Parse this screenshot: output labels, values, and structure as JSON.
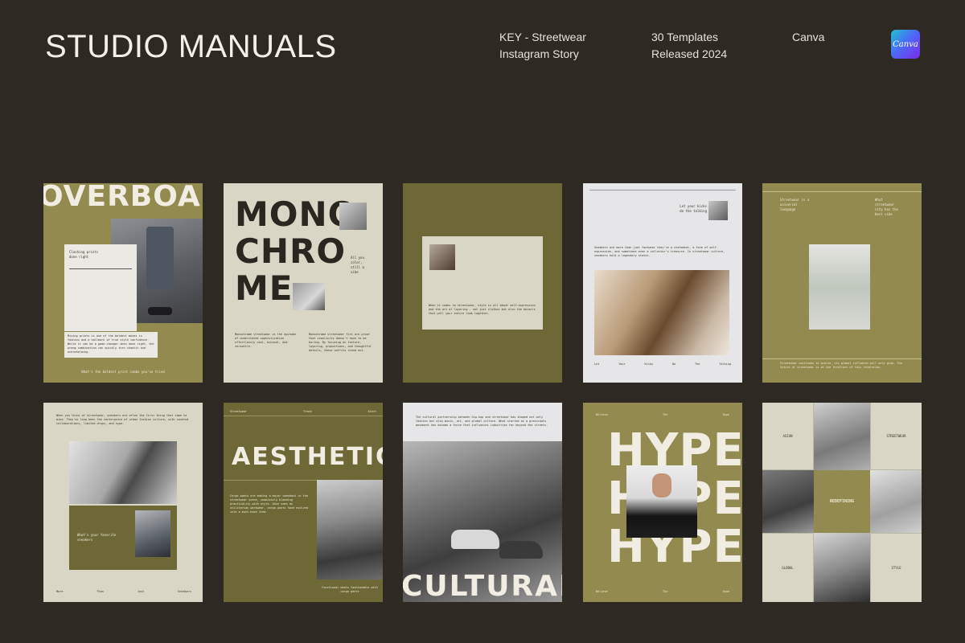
{
  "header": {
    "brand": "STUDIO MANUALS",
    "product_line1": "KEY - Streetwear",
    "product_line2": "Instagram Story",
    "count_line1": "30 Templates",
    "count_line2": "Released 2024",
    "platform": "Canva",
    "logo_text": "Canva"
  },
  "cards": {
    "c1": {
      "headline": "OVERBOARD",
      "note": "Clashing prints done right",
      "body": "Mixing prints is one of the boldest moves in fashion and a hallmark of true style confidence. While it can be a game-changer when done right, the wrong combination can quickly turn chaotic and overwhelming.",
      "footer": "What's the boldest print combo you've tried"
    },
    "c2": {
      "line1": "MONO",
      "line2": "CHRO",
      "line3": "ME",
      "side": "All you color, still a vibe",
      "col1": "Monochrome streetwear is the epitome of understated sophistication effortlessly cool, minimal, and versatile.",
      "col2": "Monochrome streetwear fits are proof that simplicity doesn't have to be boring. By focusing on texture, layering, proportions, and thoughtful details, these outfits stand out."
    },
    "c3": {
      "body": "When it comes to streetwear, style is all about self-expression and the art of layering - not just clothes but also the details that pull your entire look together."
    },
    "c4": {
      "caption": "Let your kicks do the talking",
      "body": "Sneakers are more than just footwear they're a statement, a form of self-expression, and sometimes even a collector's treasure. In streetwear culture, sneakers hold a legendary status.",
      "w1": "Let",
      "w2": "Your",
      "w3": "Kicks",
      "w4": "Do",
      "w5": "The",
      "w6": "Talking"
    },
    "c5": {
      "left": "Streetwear is a universal language",
      "right": "What streetwear city has the best vibe",
      "body": "Streetwear continues to evolve, its global influence will only grow. The future of streetwear is at the forefront of this revolution."
    },
    "c6": {
      "body": "When you think of streetwear, sneakers are often the first thing that come to mind. They've long been the centerpiece of urban fashion culture, with coveted collaborations, limited drops, and hype.",
      "question": "What's your favorite sneakers",
      "f1": "More",
      "f2": "Than",
      "f3": "Just",
      "f4": "Sneakers"
    },
    "c7": {
      "t1": "Streetwear",
      "t2": "Trend",
      "t3": "Alert",
      "headline": "AESTHETICS",
      "body": "Cargo pants are making a major comeback in the streetwear scene, seamlessly blending practicality with style. Once seen as utilitarian workwear, cargo pants have evolved into a must-have item.",
      "caption": "Functional meets fashionable with cargo pants"
    },
    "c8": {
      "body": "The cultural partnership between hip-hop and streetwear has shaped not only fashion but also music, art, and global culture. What started as a grassroots movement has become a force that influences industries far beyond the streets.",
      "headline": "CULTURAL"
    },
    "c9": {
      "t1": "Believe",
      "t2": "The",
      "t3": "Hype",
      "h1": "HYPE",
      "h2": "HYPE",
      "h3": "HYPE",
      "b1": "Believe",
      "b2": "The",
      "b3": "Hype"
    },
    "c10": {
      "asian": "ASIAN",
      "streetwear": "STREETWEAR",
      "redefining": "REDEFINING",
      "global": "GLOBAL",
      "style": "STYLE"
    }
  },
  "colors": {
    "background": "#2e2923",
    "olive": "#928a4f",
    "dark_olive": "#6e6837",
    "cream": "#dad6c6"
  }
}
